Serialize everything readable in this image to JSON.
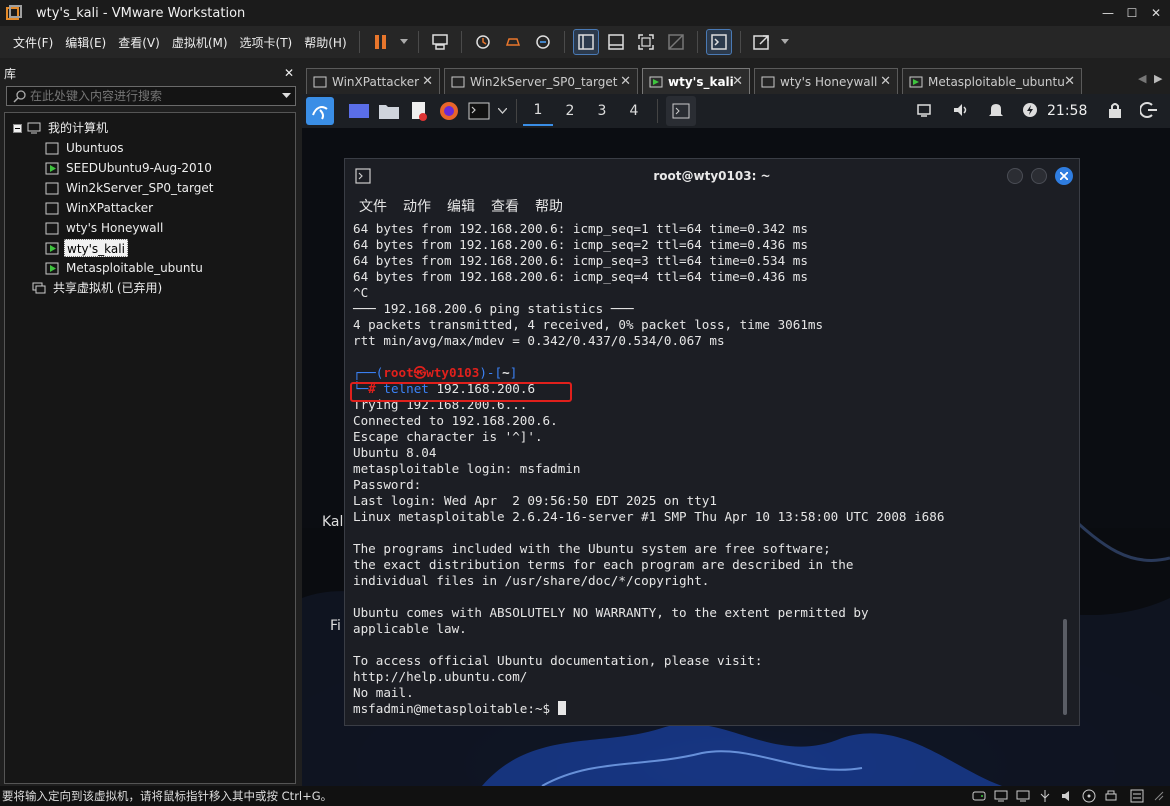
{
  "window": {
    "title": "wty's_kali - VMware Workstation",
    "min": "—",
    "max": "☐",
    "close": "✕"
  },
  "menu": [
    "文件(F)",
    "编辑(E)",
    "查看(V)",
    "虚拟机(M)",
    "选项卡(T)",
    "帮助(H)"
  ],
  "library": {
    "title": "库",
    "close": "✕",
    "search_placeholder": "在此处键入内容进行搜索",
    "root": "我的计算机",
    "vms": [
      "Ubuntuos",
      "SEEDUbuntu9-Aug-2010",
      "Win2kServer_SP0_target",
      "WinXPattacker",
      "wty's Honeywall",
      "wty's_kali",
      "Metasploitable_ubuntu"
    ],
    "selected_index": 5,
    "shared": "共享虚拟机 (已弃用)"
  },
  "tabs": [
    {
      "label": "WinXPattacker",
      "active": false
    },
    {
      "label": "Win2kServer_SP0_target",
      "active": false
    },
    {
      "label": "wty's_kali",
      "active": true
    },
    {
      "label": "wty's Honeywall",
      "active": false
    },
    {
      "label": "Metasploitable_ubuntu",
      "active": false
    }
  ],
  "kali_panel": {
    "workspaces": [
      "1",
      "2",
      "3",
      "4"
    ],
    "current_workspace": "1",
    "clock": "21:58"
  },
  "terminal": {
    "title": "root@wty0103: ~",
    "menu": [
      "文件",
      "动作",
      "编辑",
      "查看",
      "帮助"
    ],
    "ping_lines": [
      "64 bytes from 192.168.200.6: icmp_seq=1 ttl=64 time=0.342 ms",
      "64 bytes from 192.168.200.6: icmp_seq=2 ttl=64 time=0.436 ms",
      "64 bytes from 192.168.200.6: icmp_seq=3 ttl=64 time=0.534 ms",
      "64 bytes from 192.168.200.6: icmp_seq=4 ttl=64 time=0.436 ms",
      "^C",
      "─── 192.168.200.6 ping statistics ───",
      "4 packets transmitted, 4 received, 0% packet loss, time 3061ms",
      "rtt min/avg/max/mdev = 0.342/0.437/0.534/0.067 ms",
      ""
    ],
    "prompt_user": "root㉿wty0103",
    "prompt_dir": "~",
    "command_name": "telnet",
    "command_arg": "192.168.200.6",
    "output_lines": [
      "Trying 192.168.200.6...",
      "Connected to 192.168.200.6.",
      "Escape character is '^]'.",
      "Ubuntu 8.04",
      "metasploitable login: msfadmin",
      "Password:",
      "Last login: Wed Apr  2 09:56:50 EDT 2025 on tty1",
      "Linux metasploitable 2.6.24-16-server #1 SMP Thu Apr 10 13:58:00 UTC 2008 i686",
      "",
      "The programs included with the Ubuntu system are free software;",
      "the exact distribution terms for each program are described in the",
      "individual files in /usr/share/doc/*/copyright.",
      "",
      "Ubuntu comes with ABSOLUTELY NO WARRANTY, to the extent permitted by",
      "applicable law.",
      "",
      "To access official Ubuntu documentation, please visit:",
      "http://help.ubuntu.com/",
      "No mail."
    ],
    "final_prompt": "msfadmin@metasploitable:~$ "
  },
  "desktop_fragments": {
    "kal": "Kal",
    "fi": "Fi"
  },
  "status": "要将输入定向到该虚拟机，请将鼠标指针移入其中或按 Ctrl+G。",
  "colors": {
    "accent": "#3a8ee6",
    "highlight_box": "#e0201c",
    "prompt_red": "#e0201c",
    "prompt_blue": "#3b82f6"
  }
}
